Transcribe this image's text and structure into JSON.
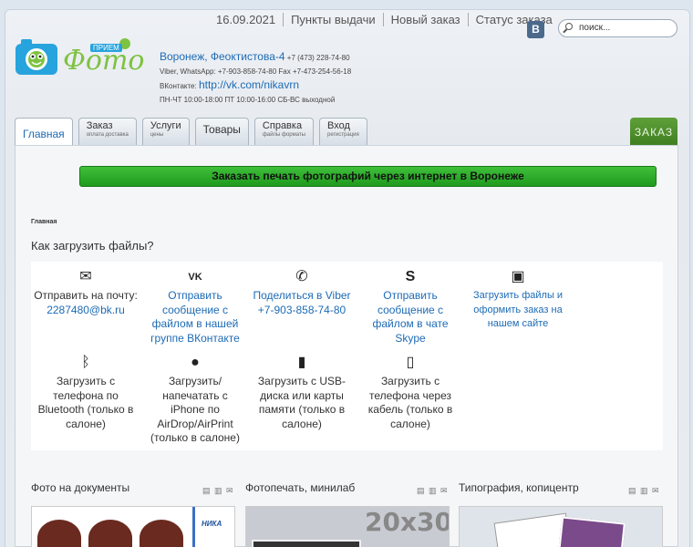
{
  "header": {
    "date": "16.09.2021",
    "nav": [
      "Пункты выдачи",
      "Новый заказ",
      "Статус заказа"
    ],
    "vk_badge": "В",
    "search_placeholder": "поиск...",
    "logo_small": "ПРИЕМ",
    "logo_big": "Фото",
    "address": "Воронеж, Феоктистова-4",
    "phone": "+7 (473) 228-74-80",
    "messengers": "Viber, WhatsApp: +7-903-858-74-80 Fax +7-473-254-56-18",
    "vk_label": "ВКонтакте:",
    "vk_link": "http://vk.com/nikavrn",
    "hours": "ПН-ЧТ 10:00-18:00 ПТ 10:00-16:00 СБ-ВС выходной"
  },
  "tabs": [
    {
      "label": "Главная",
      "sub": ""
    },
    {
      "label": "Заказ",
      "sub": "оплата доставка"
    },
    {
      "label": "Услуги",
      "sub": "цены"
    },
    {
      "label": "Товары",
      "sub": ""
    },
    {
      "label": "Справка",
      "sub": "файлы форматы"
    },
    {
      "label": "Вход",
      "sub": "регистрация"
    }
  ],
  "order_tab": "ЗАКАЗ",
  "banner": "Заказать печать фотографий через интернет в Воронеже",
  "breadcrumb": "Главная",
  "howto_title": "Как загрузить файлы?",
  "upload": {
    "email": {
      "l1": "Отправить на почту:",
      "l2": "2287480@bk.ru"
    },
    "vkgroup": {
      "l1": "Отправить",
      "l2": "сообщение с",
      "l3": "файлом в нашей",
      "l4": "группе ВКонтакте"
    },
    "viber": {
      "l1": "Поделиться в Viber",
      "l2": "+7-903-858-74-80"
    },
    "skype": {
      "l1": "Отправить",
      "l2": "сообщение с",
      "l3": "файлом в чате",
      "l4": "Skype"
    },
    "site": {
      "l1": "Загрузить файлы и",
      "l2": "оформить заказ на",
      "l3": "нашем сайте"
    },
    "bluetooth": {
      "l1": "Загрузить с",
      "l2": "телефона по",
      "l3": "Bluetooth (только в",
      "l4": "салоне)"
    },
    "airdrop": {
      "l1": "Загрузить/",
      "l2": "напечатать с",
      "l3": "iPhone по",
      "l4": "AirDrop/AirPrint",
      "l5": "(только в салоне)"
    },
    "usb": {
      "l1": "Загрузить с USB-",
      "l2": "диска или карты",
      "l3": "памяти (только в",
      "l4": "салоне)"
    },
    "cable": {
      "l1": "Загрузить с",
      "l2": "телефона через",
      "l3": "кабель (только в",
      "l4": "салоне)"
    }
  },
  "sections": [
    "Фото на документы",
    "Фотопечать, минилаб",
    "Типография, копицентр"
  ],
  "thumb_labels": {
    "nika": "НИКА",
    "size": "20х30"
  },
  "colors": {
    "accent": "#1d6bb5",
    "banner": "#2fae2b",
    "order": "#4a8a28"
  }
}
